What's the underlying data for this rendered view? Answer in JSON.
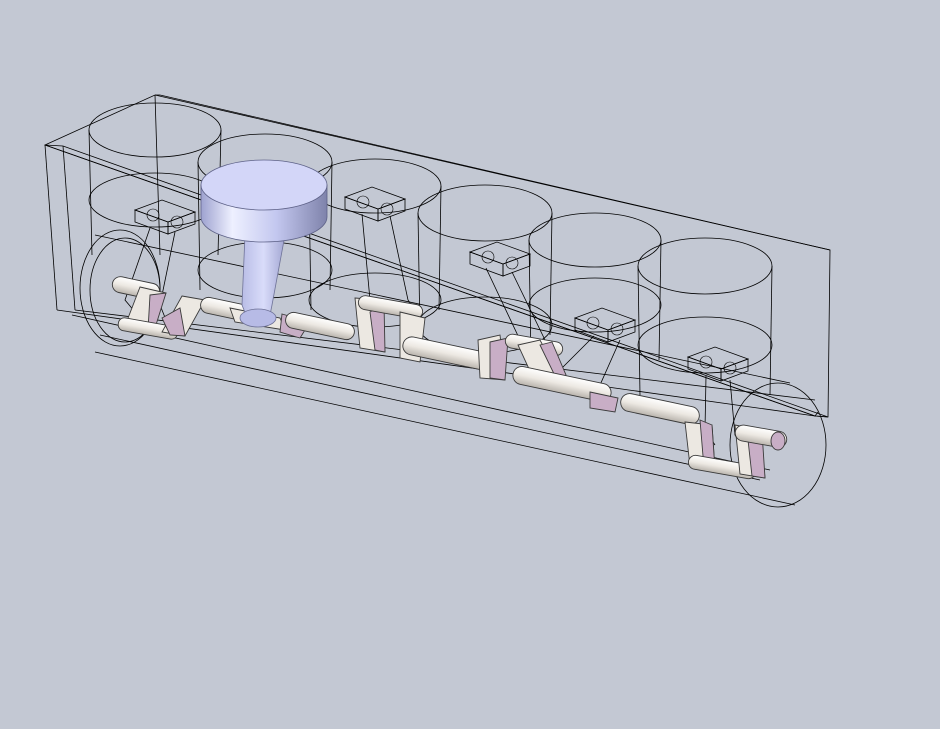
{
  "viewport": {
    "background_color": "#c3c8d3",
    "wireframe_color": "#000000",
    "crank_fill_color": "#ece8e2",
    "crank_shade_color": "#c8aec6",
    "piston_highlight_color": "#c9cdf2",
    "piston_shadow_color": "#8f92b8"
  },
  "model": {
    "assembly": "inline-six-engine",
    "cylinder_count": 6,
    "highlighted_cylinder": 2,
    "display_mode": "wireframe-with-shaded-crankshaft",
    "icons": {
      "engine_block": "engine-block-wireframe",
      "piston": "piston-icon",
      "connecting_rod": "connecting-rod-icon",
      "crankshaft": "crankshaft-icon",
      "flywheel": "flywheel-icon"
    }
  }
}
